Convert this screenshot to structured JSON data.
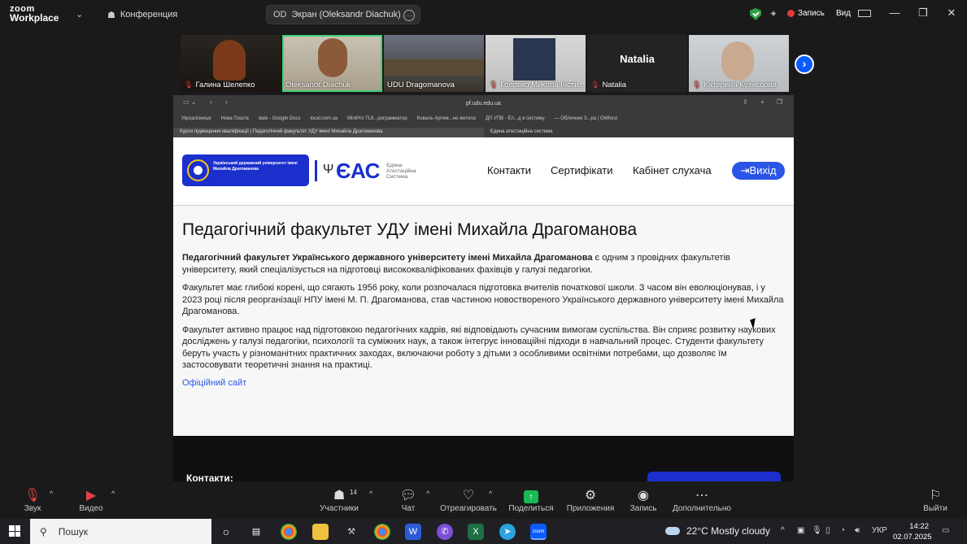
{
  "topbar": {
    "logo_top": "zoom",
    "logo_bottom": "Workplace",
    "tab_conference": "Конференция",
    "tab_screen_badge": "OD",
    "tab_screen": "Экран (Oleksandr Diachuk)",
    "record_label": "Запись",
    "view_label": "Вид"
  },
  "participants": [
    {
      "name": "Галина Шелепко",
      "muted": true
    },
    {
      "name": "Oleksandr Diachuk",
      "muted": false
    },
    {
      "name": "UDU Dragomanova",
      "muted": false
    },
    {
      "name": "Головко Микола Інсти...",
      "muted": true
    },
    {
      "name": "Natalia",
      "muted": true,
      "big_name": "Natalia"
    },
    {
      "name": "Катерина Кузнєцова",
      "muted": true
    }
  ],
  "browser": {
    "url": "pf.udu.edu.ua",
    "bookmarks": [
      "Укрзалізниця",
      "Нова Пошта",
      "date - Google Docs",
      "local.com.ua",
      "MiniPro TL8...рограмматор",
      "Коваль Артем...не житела",
      "ДП УПВ - Ел...д в систему",
      "— Облечник З...ра | GMhost"
    ],
    "tab_active": "Курси підвищення кваліфікації | Педагогічний факультет УДУ імені Михайла Драгоманова",
    "tab_other": "Єдина атестаційна система"
  },
  "site": {
    "udu_logo_text": "Український державний університет імені Михайла Драгоманова",
    "eas_logo": "ЄАС",
    "eas_sub": "Єдина Атестаційна Система",
    "nav": [
      "Контакти",
      "Сертифікати",
      "Кабінет слухача"
    ],
    "logout": "Вихід",
    "title": "Педагогічний факультет УДУ імені Михайла Драгоманова",
    "p1_bold": "Педагогічний факультет Українського державного університету імені Михайла Драгоманова",
    "p1_rest": " є одним з провідних факультетів університету, який спеціалізується на підготовці висококваліфікованих фахівців у галузі педагогіки.",
    "p2": "Факультет має глибокі корені, що сягають 1956 року, коли розпочалася підготовка вчителів початкової школи. З часом він еволюціонував, і у 2023 році після реорганізації НПУ імені М. П. Драгоманова, став частиною новоствореного Українського державного університету імені Михайла Драгоманова.",
    "p3": "Факультет активно працює над підготовкою педагогічних кадрів, які відповідають сучасним вимогам суспільства. Він сприяє розвитку наукових досліджень у галузі педагогіки, психології та суміжних наук, а також інтегрує інноваційні підходи в навчальний процес. Студенти факультету беруть участь у різноманітних практичних заходах, включаючи роботу з дітьми з особливими освітніми потребами, що дозволяє їм застосовувати теоретичні знання на практиці.",
    "link": "Офіційний сайт",
    "footer_label": "Контакти:"
  },
  "controls": {
    "sound": "Звук",
    "video": "Видео",
    "participants": "Участники",
    "participants_count": "14",
    "chat": "Чат",
    "react": "Отреагировать",
    "share": "Поделиться",
    "apps": "Приложения",
    "record": "Запись",
    "more": "Дополнительно",
    "leave": "Выйти"
  },
  "taskbar": {
    "search": "Пошук",
    "weather": "22°C  Mostly cloudy",
    "lang": "УКР",
    "time": "14:22",
    "date": "02.07.2025"
  }
}
